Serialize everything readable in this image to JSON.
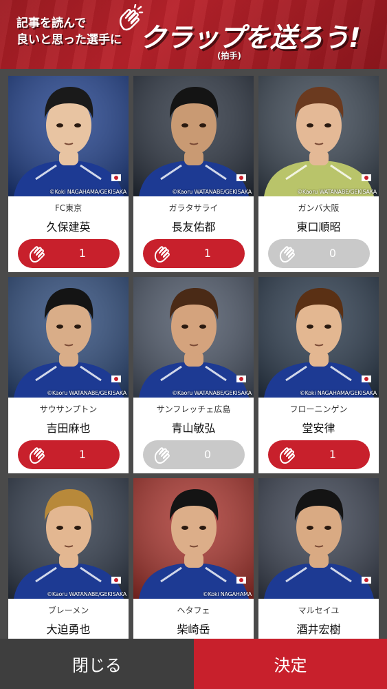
{
  "banner": {
    "line1": "記事を読んで",
    "line2": "良いと思った選手に",
    "headline": "クラップを送ろう!",
    "note": "(拍手)"
  },
  "colors": {
    "accent": "#c8202c",
    "inactive": "#c9c9c9",
    "close_bg": "#3e3e3e"
  },
  "players": [
    {
      "team": "FC東京",
      "name": "久保建英",
      "count": "1",
      "active": true,
      "credit": "©Koki NAGAHAMA/GEKISAKA",
      "bg": "#1f3f8a",
      "kit": "#1d3a93",
      "skin": "#e8c4a2",
      "hair": "#1a1a1a"
    },
    {
      "team": "ガラタサライ",
      "name": "長友佑都",
      "count": "1",
      "active": true,
      "credit": "©Kaoru WATANABE/GEKISAKA",
      "bg": "#2b3340",
      "kit": "#1d3a93",
      "skin": "#c99a73",
      "hair": "#141414"
    },
    {
      "team": "ガンバ大阪",
      "name": "東口順昭",
      "count": "0",
      "active": false,
      "credit": "©Kaoru WATANABE/GEKISAKA",
      "bg": "#3a4552",
      "kit": "#b9c46a",
      "skin": "#e4b996",
      "hair": "#6b3a1f"
    },
    {
      "team": "サウサンプトン",
      "name": "吉田麻也",
      "count": "1",
      "active": true,
      "credit": "©Kaoru WATANABE/GEKISAKA",
      "bg": "#2d4a7a",
      "kit": "#1d3a93",
      "skin": "#d9ad88",
      "hair": "#141414"
    },
    {
      "team": "サンフレッチェ広島",
      "name": "青山敏弘",
      "count": "0",
      "active": false,
      "credit": "©Kaoru WATANABE/GEKISAKA",
      "bg": "#4b5566",
      "kit": "#1d3a93",
      "skin": "#d4a37d",
      "hair": "#4a2a16"
    },
    {
      "team": "フローニンゲン",
      "name": "堂安律",
      "count": "1",
      "active": true,
      "credit": "©Koki NAGAHAMA/GEKISAKA",
      "bg": "#2b3a4c",
      "kit": "#1d3a93",
      "skin": "#e3b791",
      "hair": "#5a3014"
    },
    {
      "team": "ブレーメン",
      "name": "大迫勇也",
      "count": "",
      "active": null,
      "credit": "©Kaoru WATANABE/GEKISAKA",
      "bg": "#303a4a",
      "kit": "#1d3a93",
      "skin": "#e3b791",
      "hair": "#b8893a"
    },
    {
      "team": "ヘタフェ",
      "name": "柴崎岳",
      "count": "",
      "active": null,
      "credit": "©Koki NAGAHAMA",
      "bg": "#a8332c",
      "kit": "#1d3a93",
      "skin": "#dcae89",
      "hair": "#141414"
    },
    {
      "team": "マルセイユ",
      "name": "酒井宏樹",
      "count": "",
      "active": null,
      "credit": "",
      "bg": "#3a4150",
      "kit": "#1d3a93",
      "skin": "#d9aa83",
      "hair": "#141414"
    }
  ],
  "footer": {
    "close_label": "閉じる",
    "submit_label": "決定"
  }
}
